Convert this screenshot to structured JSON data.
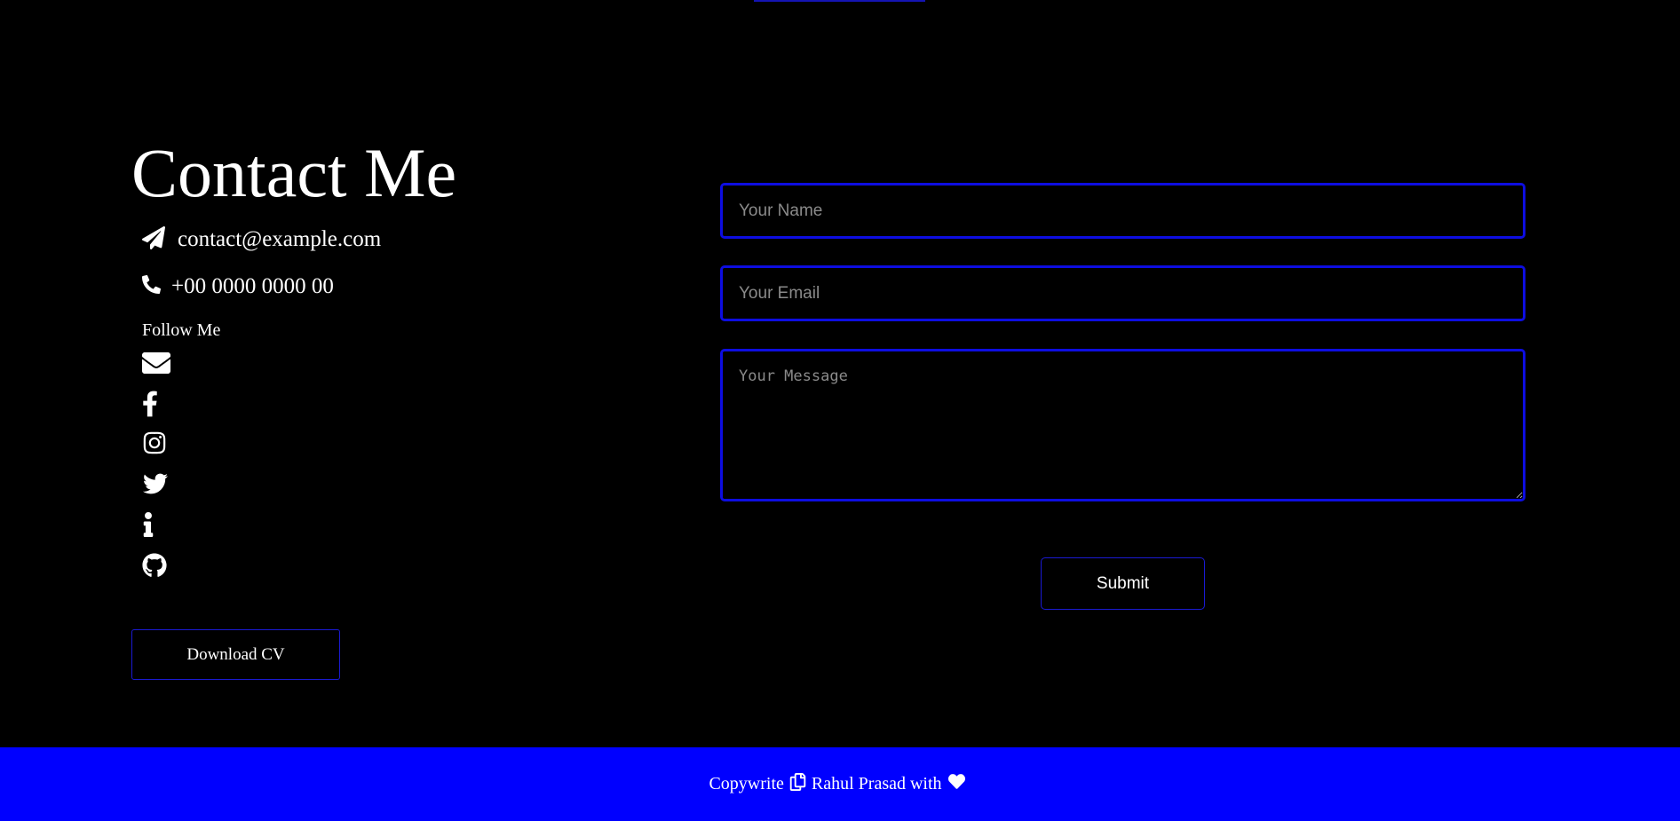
{
  "contact": {
    "title": "Contact Me",
    "email": "contact@example.com",
    "phone": "+00 0000 0000 00",
    "follow_title": "Follow Me",
    "download_cv_label": "Download CV"
  },
  "icons": {
    "email": "paper-plane-icon",
    "phone": "phone-icon",
    "social": [
      "envelope-icon",
      "facebook-icon",
      "instagram-icon",
      "twitter-icon",
      "info-icon",
      "github-icon"
    ]
  },
  "form": {
    "name_placeholder": "Your Name",
    "email_placeholder": "Your Email",
    "message_placeholder": "Your Message",
    "submit_label": "Submit"
  },
  "footer": {
    "prefix": "Copywrite",
    "author": "Rahul Prasad with"
  },
  "colors": {
    "background": "#000000",
    "accent": "#0000ff",
    "border": "#0d0de0",
    "text": "#ffffff"
  }
}
